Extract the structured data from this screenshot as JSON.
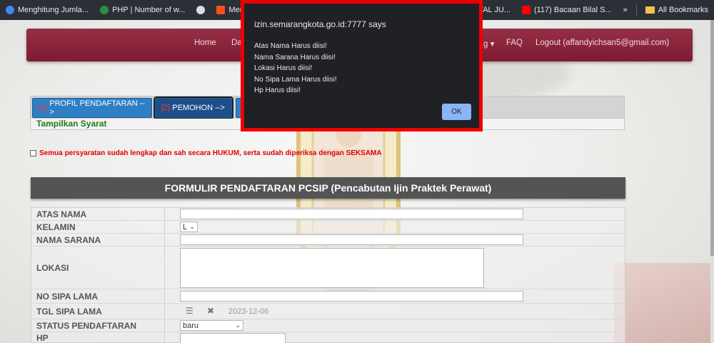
{
  "bookmarks": {
    "items": [
      {
        "label": "Menghitung Jumla...",
        "color": "#4285f4"
      },
      {
        "label": "PHP | Number of w...",
        "color": "#2f8d46"
      },
      {
        "label": "",
        "color": "#dadce0"
      },
      {
        "label": "Menghitung Ju",
        "color": "#f4511e"
      }
    ],
    "right_items": [
      {
        "label": "(26) MUROTTAL JU...",
        "color": "#ff0000"
      },
      {
        "label": "(117) Bacaan Bilal S...",
        "color": "#ff0000"
      }
    ],
    "more": "»",
    "all_bookmarks": "All Bookmarks"
  },
  "nav": {
    "home": "Home",
    "dat": "Dat",
    "caret": "g ▾",
    "faq": "FAQ",
    "logout": "Logout (affandyichsan5@gmail.com)"
  },
  "steps": [
    {
      "num": "[1]",
      "label": "PROFIL PENDAFTARAN -->"
    },
    {
      "num": "[2]",
      "label": "PEMOHON -->"
    }
  ],
  "syarat": "Tampilkan Syarat",
  "agree_text": "Semua persyaratan sudah lengkap dan sah secara HUKUM, serta sudah diperiksa dengan SEKSAMA",
  "form_title": "FORMULIR PENDAFTARAN PCSIP (Pencabutan Ijin Praktek Perawat)",
  "form": {
    "atas_nama": "ATAS NAMA",
    "kelamin": "KELAMIN",
    "kelamin_value": "L",
    "nama_sarana": "NAMA SARANA",
    "lokasi": "LOKASI",
    "no_sipa_lama": "NO SIPA LAMA",
    "tgl_sipa_lama": "TGL SIPA LAMA",
    "tgl_value": "2023-12-06",
    "status": "STATUS PENDAFTARAN",
    "status_value": "baru",
    "hp": "HP"
  },
  "dialog": {
    "title": "izin.semarangkota.go.id:7777 says",
    "messages": [
      "Atas Nama Harus diisi!",
      "Nama Sarana Harus diisi!",
      "Lokasi Harus diisi!",
      "No Sipa Lama Harus diisi!",
      "Hp Harus diisi!"
    ],
    "ok": "OK"
  }
}
